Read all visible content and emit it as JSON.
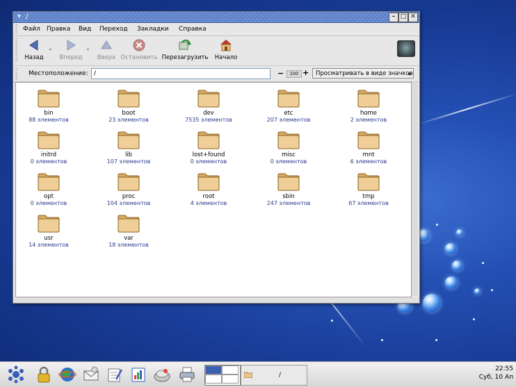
{
  "window": {
    "title": "/",
    "menu_button": "▾",
    "minimize": "–",
    "maximize": "□",
    "close": "✕"
  },
  "menubar": {
    "items": [
      "Файл",
      "Правка",
      "Вид",
      "Переход",
      "Закладки",
      "Справка"
    ]
  },
  "toolbar": {
    "back": "Назад",
    "forward": "Вперед",
    "up": "Вверх",
    "stop": "Остановить",
    "reload": "Перезагрузить",
    "home": "Начало"
  },
  "location": {
    "label": "Местоположение:",
    "value": "/",
    "zoom_minus": "−",
    "zoom_value": "100",
    "zoom_plus": "+",
    "view_as": "Просматривать в виде значков"
  },
  "folders": [
    {
      "name": "bin",
      "count": "88 элементов"
    },
    {
      "name": "boot",
      "count": "23 элементов"
    },
    {
      "name": "dev",
      "count": "7535 элементов"
    },
    {
      "name": "etc",
      "count": "207 элементов"
    },
    {
      "name": "home",
      "count": "2 элементов"
    },
    {
      "name": "initrd",
      "count": "0 элементов"
    },
    {
      "name": "lib",
      "count": "107 элементов"
    },
    {
      "name": "lost+found",
      "count": "0 элементов"
    },
    {
      "name": "misc",
      "count": "0 элементов"
    },
    {
      "name": "mnt",
      "count": "6 элементов"
    },
    {
      "name": "opt",
      "count": "0 элементов"
    },
    {
      "name": "proc",
      "count": "104 элементов"
    },
    {
      "name": "root",
      "count": "4 элементов"
    },
    {
      "name": "sbin",
      "count": "247 элементов"
    },
    {
      "name": "tmp",
      "count": "67 элементов"
    },
    {
      "name": "usr",
      "count": "14 элементов"
    },
    {
      "name": "var",
      "count": "18 элементов"
    }
  ],
  "taskbar": {
    "task_label": "/",
    "time": "22:55",
    "date": "Суб, 10 Ап"
  },
  "icons": {
    "back": "back-arrow-icon",
    "forward": "forward-arrow-icon",
    "up": "up-arrow-icon",
    "stop": "stop-icon",
    "reload": "reload-icon",
    "home": "home-icon",
    "folder": "folder-icon"
  },
  "colors": {
    "desktop_blue": "#1f47a8",
    "titlebar": "#6283cc",
    "folder_fill": "#e8c48a",
    "count_text": "#2b3a8c"
  }
}
